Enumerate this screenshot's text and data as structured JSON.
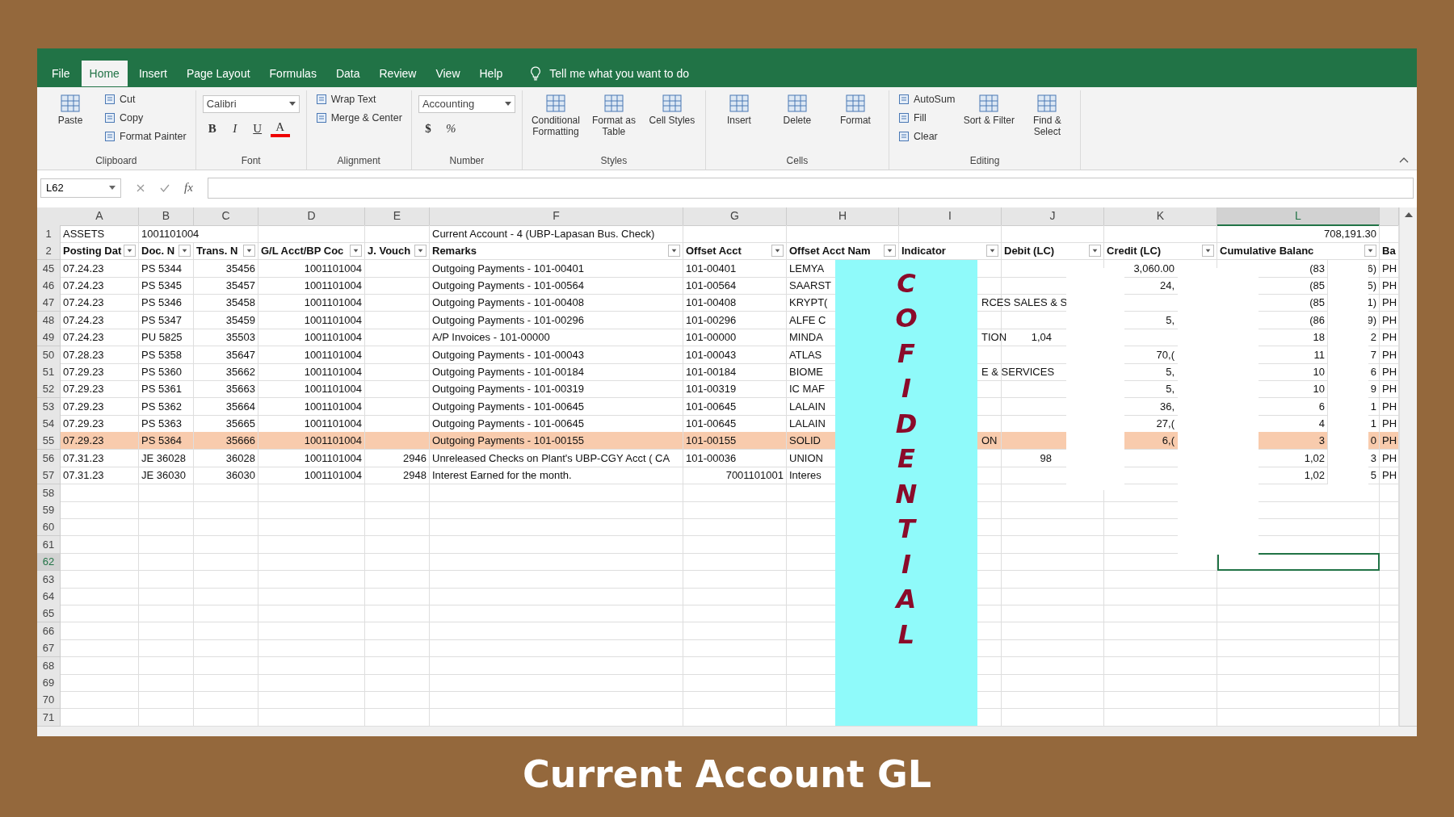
{
  "window": {
    "tabs": [
      {
        "label": "File",
        "selected": false
      },
      {
        "label": "Home",
        "selected": true
      },
      {
        "label": "Insert",
        "selected": false
      },
      {
        "label": "Page Layout",
        "selected": false
      },
      {
        "label": "Formulas",
        "selected": false
      },
      {
        "label": "Data",
        "selected": false
      },
      {
        "label": "Review",
        "selected": false
      },
      {
        "label": "View",
        "selected": false
      },
      {
        "label": "Help",
        "selected": false
      }
    ],
    "tell_me": "Tell me what you want to do"
  },
  "ribbon": {
    "groups": [
      {
        "label": "Clipboard",
        "items": [
          {
            "kind": "large",
            "label": "Paste"
          },
          {
            "kind": "small",
            "label": "Cut"
          },
          {
            "kind": "small",
            "label": "Copy"
          },
          {
            "kind": "small",
            "label": "Format Painter"
          }
        ]
      },
      {
        "label": "Font",
        "items": [
          {
            "kind": "field",
            "label": "Calibri"
          },
          {
            "kind": "glyphs",
            "labels": [
              "B",
              "I",
              "U",
              "A"
            ]
          }
        ]
      },
      {
        "label": "Alignment",
        "items": [
          {
            "kind": "small",
            "label": "Wrap Text"
          },
          {
            "kind": "small",
            "label": "Merge & Center"
          }
        ]
      },
      {
        "label": "Number",
        "items": [
          {
            "kind": "field",
            "label": "Accounting"
          },
          {
            "kind": "glyphs",
            "labels": [
              "$",
              "%"
            ]
          }
        ]
      },
      {
        "label": "Styles",
        "items": [
          {
            "kind": "large",
            "label": "Conditional Formatting"
          },
          {
            "kind": "large",
            "label": "Format as Table"
          },
          {
            "kind": "large",
            "label": "Cell Styles"
          }
        ]
      },
      {
        "label": "Cells",
        "items": [
          {
            "kind": "large",
            "label": "Insert"
          },
          {
            "kind": "large",
            "label": "Delete"
          },
          {
            "kind": "large",
            "label": "Format"
          }
        ]
      },
      {
        "label": "Editing",
        "items": [
          {
            "kind": "small",
            "label": "AutoSum"
          },
          {
            "kind": "small",
            "label": "Fill"
          },
          {
            "kind": "small",
            "label": "Clear"
          },
          {
            "kind": "large",
            "label": "Sort & Filter"
          },
          {
            "kind": "large",
            "label": "Find & Select"
          }
        ]
      }
    ]
  },
  "formula_bar": {
    "name_box": "L62",
    "function_label": "fx"
  },
  "sheet": {
    "column_headers": [
      {
        "label": "A",
        "selected": false
      },
      {
        "label": "B",
        "selected": false
      },
      {
        "label": "C",
        "selected": false
      },
      {
        "label": "D",
        "selected": false
      },
      {
        "label": "E",
        "selected": false
      },
      {
        "label": "F",
        "selected": false
      },
      {
        "label": "G",
        "selected": false
      },
      {
        "label": "H",
        "selected": false
      },
      {
        "label": "I",
        "selected": false
      },
      {
        "label": "J",
        "selected": false
      },
      {
        "label": "K",
        "selected": false
      },
      {
        "label": "L",
        "selected": true
      }
    ],
    "rows": [
      {
        "number": "1",
        "kind": "title",
        "selected": false,
        "cells": [
          "ASSETS",
          "1001101004",
          null,
          null,
          null,
          "Current Account - 4 (UBP-Lapasan Bus. Check)",
          null,
          null,
          null,
          null,
          null,
          "708,191.30",
          null
        ]
      },
      {
        "number": "2",
        "kind": "header",
        "selected": false,
        "cells": [
          "Posting Dat",
          "Doc. N",
          "Trans. N",
          "G/L Acct/BP Coc",
          "J. Vouch",
          "Remarks",
          "Offset Acct",
          "Offset Acct Nam",
          "Indicator",
          "Debit (LC)",
          "Credit (LC)",
          "Cumulative Balanc",
          "Ba"
        ]
      },
      {
        "number": "45",
        "kind": "data",
        "selected": false,
        "highlighted": false,
        "cells": [
          "07.24.23",
          "PS 5344",
          "35456",
          "1001101004",
          null,
          "Outgoing Payments - 101-00401",
          "101-00401",
          "LEMYA",
          null,
          null,
          "3,060.00",
          "(83",
          "6)",
          "PH"
        ]
      },
      {
        "number": "46",
        "kind": "data",
        "selected": false,
        "highlighted": false,
        "cells": [
          "07.24.23",
          "PS 5345",
          "35457",
          "1001101004",
          null,
          "Outgoing Payments - 101-00564",
          "101-00564",
          "SAARST",
          null,
          null,
          "24,",
          "(85",
          "5)",
          "PH"
        ]
      },
      {
        "number": "47",
        "kind": "data",
        "selected": false,
        "highlighted": false,
        "cells": [
          "07.24.23",
          "PS 5346",
          "35458",
          "1001101004",
          null,
          "Outgoing Payments - 101-00408",
          "101-00408",
          "KRYPT(",
          "RCES SALES & S",
          null,
          null,
          "(85",
          "1)",
          "PH"
        ]
      },
      {
        "number": "48",
        "kind": "data",
        "selected": false,
        "highlighted": false,
        "cells": [
          "07.24.23",
          "PS 5347",
          "35459",
          "1001101004",
          null,
          "Outgoing Payments - 101-00296",
          "101-00296",
          "ALFE C",
          null,
          null,
          "5,",
          "(86",
          "9)",
          "PH"
        ]
      },
      {
        "number": "49",
        "kind": "data",
        "selected": false,
        "highlighted": false,
        "cells": [
          "07.24.23",
          "PU 5825",
          "35503",
          "1001101004",
          null,
          "A/P Invoices - 101-00000",
          "101-00000",
          "MINDA",
          "TION",
          "1,04",
          null,
          "18",
          "2",
          "PH"
        ]
      },
      {
        "number": "50",
        "kind": "data",
        "selected": false,
        "highlighted": false,
        "cells": [
          "07.28.23",
          "PS 5358",
          "35647",
          "1001101004",
          null,
          "Outgoing Payments - 101-00043",
          "101-00043",
          "ATLAS",
          null,
          null,
          "70,(",
          "11",
          "7",
          "PH"
        ]
      },
      {
        "number": "51",
        "kind": "data",
        "selected": false,
        "highlighted": false,
        "cells": [
          "07.29.23",
          "PS 5360",
          "35662",
          "1001101004",
          null,
          "Outgoing Payments - 101-00184",
          "101-00184",
          "BIOME",
          "E & SERVICES",
          null,
          "5,",
          "10",
          "6",
          "PH"
        ]
      },
      {
        "number": "52",
        "kind": "data",
        "selected": false,
        "highlighted": false,
        "cells": [
          "07.29.23",
          "PS 5361",
          "35663",
          "1001101004",
          null,
          "Outgoing Payments - 101-00319",
          "101-00319",
          "IC MAF",
          null,
          null,
          "5,",
          "10",
          "9",
          "PH"
        ]
      },
      {
        "number": "53",
        "kind": "data",
        "selected": false,
        "highlighted": false,
        "cells": [
          "07.29.23",
          "PS 5362",
          "35664",
          "1001101004",
          null,
          "Outgoing Payments - 101-00645",
          "101-00645",
          "LALAIN",
          null,
          null,
          "36,",
          "6",
          "1",
          "PH"
        ]
      },
      {
        "number": "54",
        "kind": "data",
        "selected": false,
        "highlighted": false,
        "cells": [
          "07.29.23",
          "PS 5363",
          "35665",
          "1001101004",
          null,
          "Outgoing Payments - 101-00645",
          "101-00645",
          "LALAIN",
          null,
          null,
          "27,(",
          "4",
          "1",
          "PH"
        ]
      },
      {
        "number": "55",
        "kind": "data",
        "selected": false,
        "highlighted": true,
        "cells": [
          "07.29.23",
          "PS 5364",
          "35666",
          "1001101004",
          null,
          "Outgoing Payments - 101-00155",
          "101-00155",
          "SOLID",
          "ON",
          null,
          "6,(",
          "3",
          "0",
          "PH"
        ]
      },
      {
        "number": "56",
        "kind": "data",
        "selected": false,
        "highlighted": false,
        "cells": [
          "07.31.23",
          "JE 36028",
          "36028",
          "1001101004",
          "2946",
          "Unreleased Checks on Plant's UBP-CGY Acct ( CA",
          "101-00036",
          "UNION",
          null,
          "98",
          null,
          "1,02",
          "3",
          "PH"
        ]
      },
      {
        "number": "57",
        "kind": "data",
        "selected": false,
        "highlighted": false,
        "cells": [
          "07.31.23",
          "JE 36030",
          "36030",
          "1001101004",
          "2948",
          "Interest Earned for the month.",
          "7001101001",
          "Interes",
          null,
          null,
          null,
          "1,02",
          "5",
          "PH"
        ]
      },
      {
        "number": "58",
        "kind": "empty",
        "selected": false
      },
      {
        "number": "59",
        "kind": "empty",
        "selected": false
      },
      {
        "number": "60",
        "kind": "empty",
        "selected": false
      },
      {
        "number": "61",
        "kind": "empty",
        "selected": false
      },
      {
        "number": "62",
        "kind": "empty",
        "selected": true
      },
      {
        "number": "63",
        "kind": "empty",
        "selected": false
      },
      {
        "number": "64",
        "kind": "empty",
        "selected": false
      },
      {
        "number": "65",
        "kind": "empty",
        "selected": false
      },
      {
        "number": "66",
        "kind": "empty",
        "selected": false
      },
      {
        "number": "67",
        "kind": "empty",
        "selected": false
      },
      {
        "number": "68",
        "kind": "empty",
        "selected": false
      },
      {
        "number": "69",
        "kind": "empty",
        "selected": false
      },
      {
        "number": "70",
        "kind": "empty",
        "selected": false
      },
      {
        "number": "71",
        "kind": "empty",
        "selected": false
      }
    ]
  },
  "overlay": {
    "stamp": "COFIDENTIAL"
  },
  "caption": "Current Account GL"
}
